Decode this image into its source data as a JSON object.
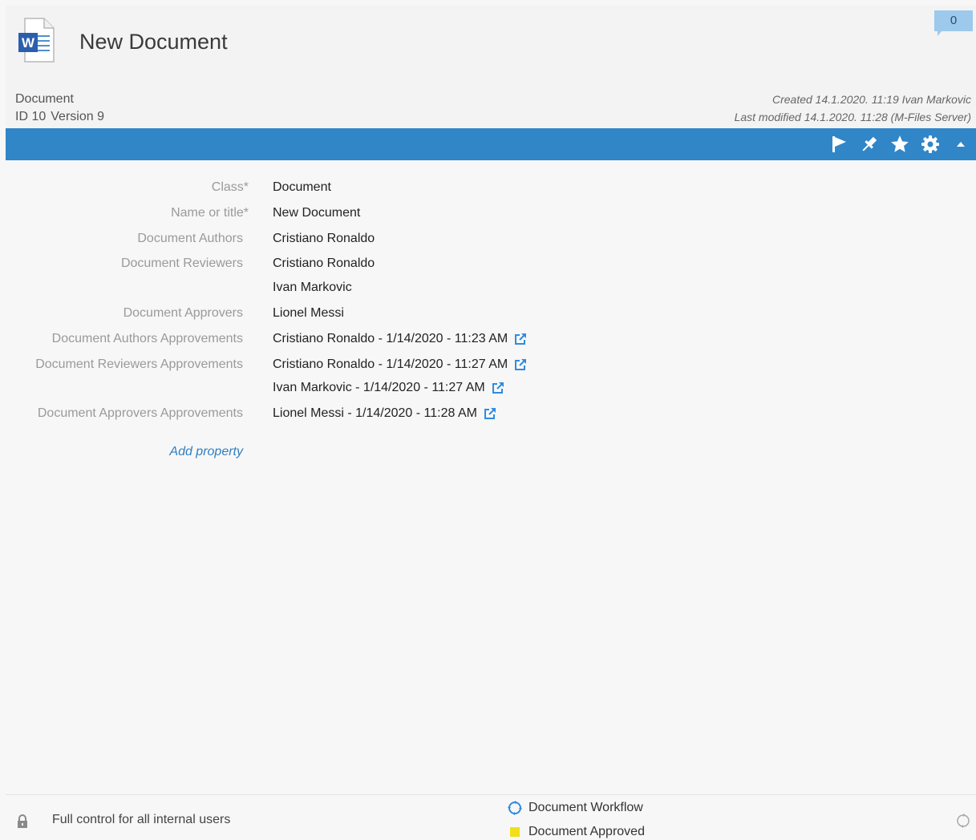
{
  "header": {
    "icon": "word-document-icon",
    "title": "New Document",
    "comment_count": "0",
    "object_type": "Document",
    "id_label": "ID 10",
    "version_label": "Version 9",
    "created": "Created 14.1.2020. 11:19 Ivan Markovic",
    "modified": "Last modified 14.1.2020. 11:28 (M-Files Server)"
  },
  "toolbar": {
    "background": "#3186c8",
    "icons": [
      "flag-icon",
      "pin-icon",
      "star-icon",
      "gear-icon",
      "collapse-icon"
    ]
  },
  "properties": [
    {
      "label": "Class*",
      "values": [
        "Document"
      ]
    },
    {
      "label": "Name or title*",
      "values": [
        "New Document"
      ]
    },
    {
      "label": "Document Authors",
      "values": [
        "Cristiano Ronaldo"
      ]
    },
    {
      "label": "Document Reviewers",
      "values": [
        "Cristiano Ronaldo",
        "Ivan Markovic"
      ]
    },
    {
      "label": "Document Approvers",
      "values": [
        "Lionel Messi"
      ]
    },
    {
      "label": "Document Authors Approvements",
      "values": [
        "Cristiano Ronaldo - 1/14/2020 - 11:23 AM"
      ]
    },
    {
      "label": "Document Reviewers Approvements",
      "values": [
        "Cristiano Ronaldo - 1/14/2020 - 11:27 AM",
        "Ivan Markovic - 1/14/2020 - 11:27 AM"
      ]
    },
    {
      "label": "Document Approvers Approvements",
      "values": [
        "Lionel Messi - 1/14/2020 - 11:28 AM"
      ]
    }
  ],
  "add_property": "Add property",
  "footer": {
    "permissions": "Full control for all internal users",
    "workflow": "Document Workflow",
    "state": "Document Approved",
    "state_color": "#f2df1a"
  }
}
